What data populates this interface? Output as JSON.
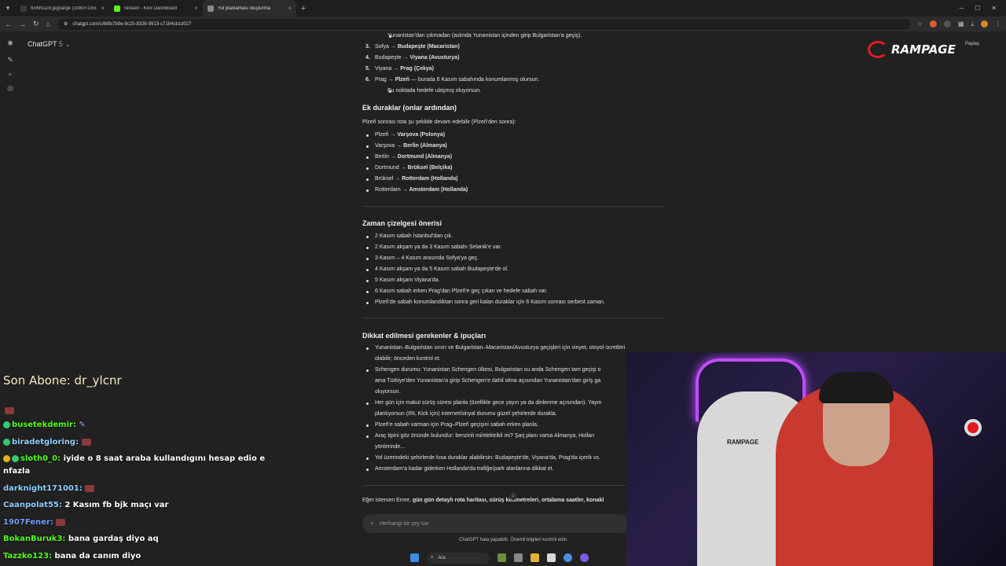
{
  "browser": {
    "tabs": [
      {
        "title": "fGlhhOZ8.jpg(large (1080×1350))",
        "color": "#3b3b3b"
      },
      {
        "title": "Stream - Kick Dashboard",
        "color": "#53fc18"
      },
      {
        "title": "Yol planlaması oluşturma",
        "color": "#888888"
      }
    ],
    "url": "chatgpt.com/c/68fe7b9e-9c20-8326-9913-c7184cb1d027"
  },
  "sidebar": {
    "model_name": "ChatGPT",
    "model_version": "5"
  },
  "content": {
    "top_sub": "Yunanistan'dan çıkmadan (aslında Yunanistan içinden girip Bulgaristan'a geçiş).",
    "route": [
      {
        "n": "3.",
        "a": "Sofya →",
        "b": "Budapeşte (Macaristan)"
      },
      {
        "n": "4.",
        "a": "Budapeşte →",
        "b": "Viyana (Avusturya)"
      },
      {
        "n": "5.",
        "a": "Viyana →",
        "b": "Prag (Çekya)"
      },
      {
        "n": "6.",
        "a": "Prag →",
        "b": "Plzeň",
        "c": "— burada 6 Kasım sabahında konumlanmış olursun."
      }
    ],
    "route_sub": "Bu noktada hedefe ulaşmış oluyorsun.",
    "extra_title": "Ek duraklar (onlar ardından)",
    "extra_intro": "Plzeň sonrası rota şu şekilde devam edebilir (Plzeň'den sonra):",
    "extra": [
      {
        "a": "Plzeň →",
        "b": "Varşova (Polonya)"
      },
      {
        "a": "Varşova →",
        "b": "Berlin (Almanya)"
      },
      {
        "a": "Berlin →",
        "b": "Dortmund (Almanya)"
      },
      {
        "a": "Dortmund →",
        "b": "Brüksel (Belçika)"
      },
      {
        "a": "Brüksel →",
        "b": "Rotterdam (Hollanda)"
      },
      {
        "a": "Rotterdam →",
        "b": "Amsterdam (Hollanda)"
      }
    ],
    "schedule_title": "Zaman çizelgesi önerisi",
    "schedule": [
      "2 Kasım sabah İstanbul'dan çık.",
      "2 Kasım akşam ya da 3 Kasım sabahı Selanik'e var.",
      "3 Kasım – 4 Kasım arasında Sofya'ya geç.",
      "4 Kasım akşam ya da 5 Kasım sabah Budapeşte'de ol.",
      "5 Kasım akşam Viyana'da.",
      "6 Kasım sabah erken Prag'dan Plzeň'e geç çıkan ve hedefe sabah var.",
      "Plzeň'de sabah konumlandıktan sonra geri kalan duraklar için 6 Kasım sonrası serbest zaman."
    ],
    "tips_title": "Dikkat edilmesi gerekenler & ipuçları",
    "tips": [
      [
        "Yunanistan–Bulgaristan sınırı ve Bulgaristan–Macaristan/Avusturya geçişleri için vinyet, otoyol ücretleri",
        "olabilir; önceden kontrol et."
      ],
      [
        "Schengen durumu: Yunanistan Schengen ülkesi, Bulgaristan su anda Schengen tam geçişi o",
        "ama Türkiye'den Yunanistan'a girip Schengen'e dahil olma açısından Yunanistan'dan giriş ga",
        "oluyorsun."
      ],
      [
        "Her gün için makul sürüş süresi planla (özellikle gece yayın ya da dinlenme açısından). Yayın",
        "planlıyorsun (IRL Kick için) internet/sinyal durumu güzel şehirlerde durakla."
      ],
      [
        "Plzeň'e sabah varman için Prag–Plzeň geçişini sabah erken planla."
      ],
      [
        "Araç tipini göz önünde bulundur: benzinli mi/elektrikli mi? Şarj planı varsa Almanya, Hollan",
        "yönlerinde..."
      ],
      [
        "Yol üzerindeki şehirlerde kısa duraklar alabilirsin: Budapeşte'de, Viyana'da, Prag'da içerik vs."
      ],
      [
        "Amsterdam'a kadar giderken Hollanda'da trafiğe/park alanlarına dikkat et."
      ]
    ],
    "closing_a": "Eğer istersen Emre,",
    "closing_b": "gün gün detaylı rota haritası, sürüş kilometreleri, ortalama saatler, konakl"
  },
  "composer": {
    "placeholder": "Herhangi bir şey sor",
    "disclaimer": "ChatGPT hata yapabilir. Önemli bilgileri kontrol edin."
  },
  "overlay": {
    "brand": "RAMPAGE",
    "share": "Paylaş",
    "subscriber": "Son Abone: dr_ylcnr",
    "chat": [
      {
        "user": "busetekdemir:",
        "msg": ""
      },
      {
        "user": "biradetgloring:",
        "msg": ""
      },
      {
        "user": "sloth0_0:",
        "msg": "iyide o 8 saat araba kullandıgını hesap edio e nfazla"
      },
      {
        "user": "darknight171001:",
        "msg": ""
      },
      {
        "user": "Caanpolat55:",
        "msg": "2 Kasım fb bjk maçı var"
      },
      {
        "user": "1907Fener:",
        "msg": ""
      },
      {
        "user": "BokanBuruk3:",
        "msg": "bana gardaş diyo aq"
      },
      {
        "user": "Tazzko123:",
        "msg": "bana da canım diyo"
      }
    ],
    "chair_brand": "RAMPAGE"
  },
  "taskbar": {
    "search": "Ara"
  }
}
